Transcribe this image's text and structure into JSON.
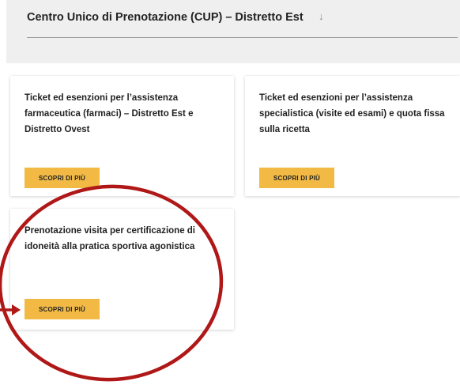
{
  "header": {
    "title": "Centro Unico di Prenotazione (CUP) – Distretto Est",
    "arrow_icon": "arrow-down-icon"
  },
  "cards": [
    {
      "title": "Ticket ed esenzioni per l’assistenza farmaceutica (farmaci) – Distretto Est e Distretto Ovest",
      "button_label": "SCOPRI DI PIÙ"
    },
    {
      "title": "Ticket ed esenzioni per l’assistenza specialistica (visite ed esami) e quota fissa sulla ricetta",
      "button_label": "SCOPRI DI PIÙ"
    },
    {
      "title": "Prenotazione visita per certificazione di idoneità alla pratica sportiva agonistica",
      "button_label": "SCOPRI DI PIÙ"
    }
  ],
  "colors": {
    "button_bg": "#f2ba45",
    "panel_bg": "#efefef",
    "annotation": "#b01818"
  }
}
